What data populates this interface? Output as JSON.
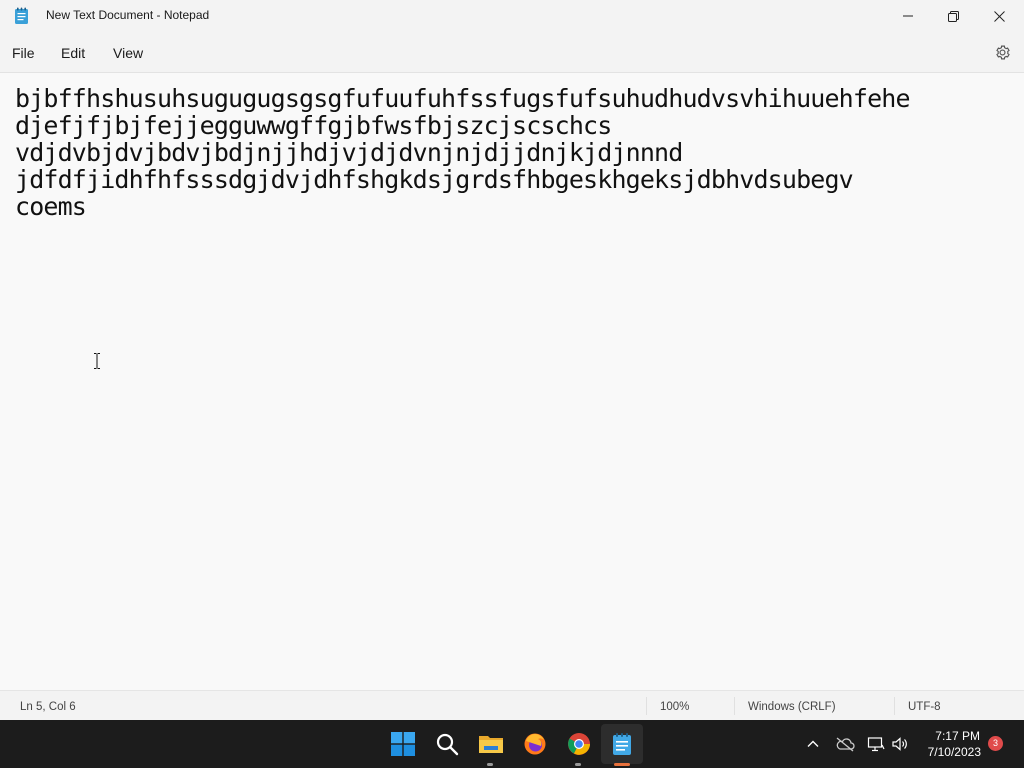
{
  "window": {
    "title": "New Text Document - Notepad",
    "minimize_icon": "minimize-icon",
    "maximize_icon": "restore-icon",
    "close_icon": "close-icon"
  },
  "menu": {
    "file": "File",
    "edit": "Edit",
    "view": "View",
    "settings_icon": "gear-icon"
  },
  "editor": {
    "lines": [
      "bjbffhshusuhsugugugsgsgfufuufuhfssfugsfufsuhudhudvsvhihuuehfehe",
      "djefjfjbjfejjegguwwgffgjbfwsfbjszcjscschcs",
      "vdjdvbjdvjbdvjbdjnjjhdjvjdjdvnjnjdjjdnjkjdjnnnd",
      "jdfdfjidhfhfsssdgjdvjdhfshgkdsjgrdsfhbgeskhgeksjdbhvdsubegv",
      "coems"
    ]
  },
  "status": {
    "position": "Ln 5, Col 6",
    "zoom": "100%",
    "line_ending": "Windows (CRLF)",
    "encoding": "UTF-8"
  },
  "taskbar": {
    "apps": [
      "start-icon",
      "search-icon",
      "file-explorer-icon",
      "firefox-icon",
      "chrome-icon",
      "notepad-icon"
    ],
    "time": "7:17 PM",
    "date": "7/10/2023",
    "notification_count": "3"
  },
  "colors": {
    "taskbar_bg": "#1c1c1c",
    "accent": "#0078d4",
    "badge": "#e04b4b"
  }
}
